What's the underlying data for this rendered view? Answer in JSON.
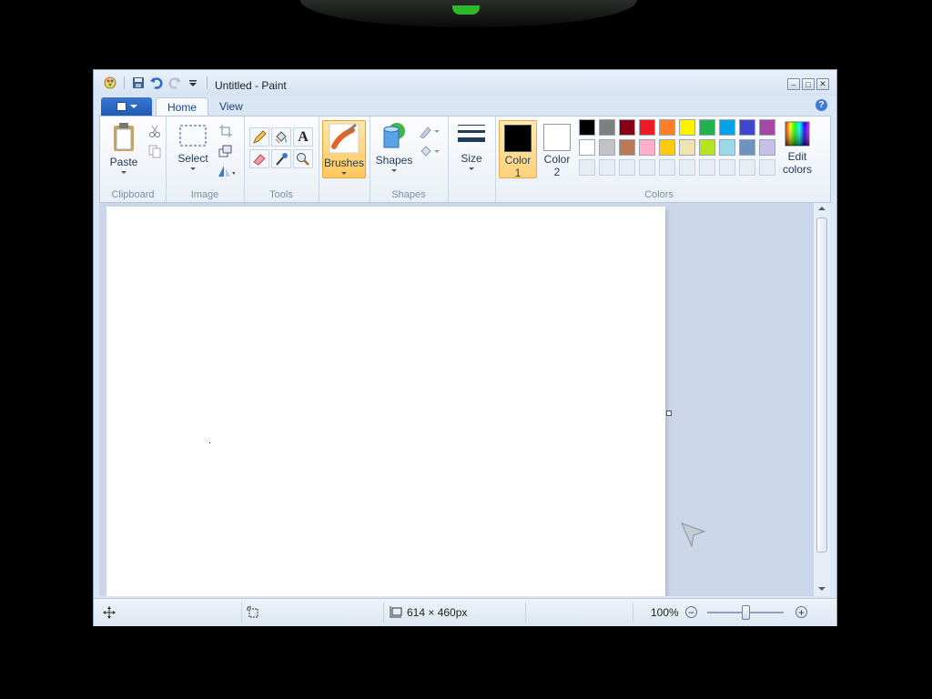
{
  "window": {
    "title": "Untitled - Paint"
  },
  "tabs": [
    {
      "label": "Home",
      "active": true
    },
    {
      "label": "View",
      "active": false
    }
  ],
  "ribbon": {
    "clipboard": {
      "group_label": "Clipboard",
      "paste_label": "Paste"
    },
    "image": {
      "group_label": "Image",
      "select_label": "Select"
    },
    "tools": {
      "group_label": "Tools"
    },
    "brushes": {
      "label": "Brushes"
    },
    "shapes": {
      "group_label": "Shapes",
      "label": "Shapes"
    },
    "size": {
      "label": "Size"
    },
    "colors": {
      "group_label": "Colors",
      "color1_label": "Color",
      "color1_num": "1",
      "color2_label": "Color",
      "color2_num": "2",
      "edit_label1": "Edit",
      "edit_label2": "colors",
      "color1_value": "#000000",
      "color2_value": "#ffffff",
      "palette_row1": [
        "#000000",
        "#7f7f7f",
        "#880015",
        "#ed1c24",
        "#ff7f27",
        "#fff200",
        "#22b14c",
        "#00a2e8",
        "#3f48cc",
        "#a349a4"
      ],
      "palette_row2": [
        "#ffffff",
        "#c3c3c3",
        "#b97a57",
        "#ffaec9",
        "#ffc90e",
        "#efe4b0",
        "#b5e61d",
        "#99d9ea",
        "#7092be",
        "#c8bfe7"
      ]
    }
  },
  "statusbar": {
    "image_size": "614 × 460px",
    "zoom": "100%"
  }
}
